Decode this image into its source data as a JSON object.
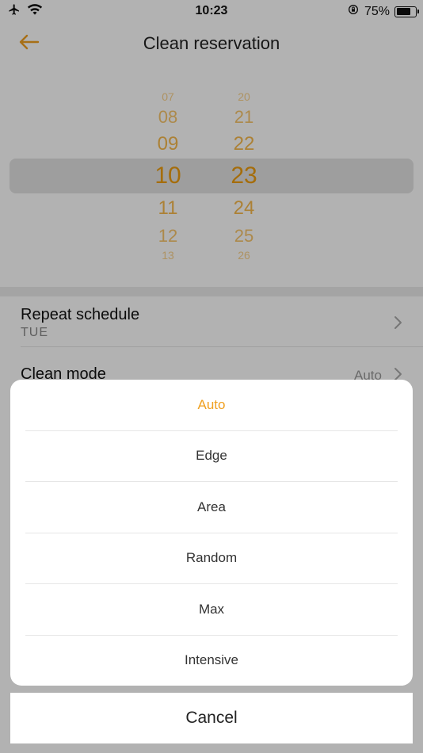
{
  "status": {
    "time": "10:23",
    "battery_text": "75%",
    "battery_level": 0.75
  },
  "nav": {
    "title": "Clean reservation",
    "accent_color": "#f0a020"
  },
  "picker": {
    "hours": [
      "07",
      "08",
      "09",
      "10",
      "11",
      "12",
      "13"
    ],
    "minutes": [
      "20",
      "21",
      "22",
      "23",
      "24",
      "25",
      "26"
    ],
    "selected_hour": "10",
    "selected_minute": "23"
  },
  "settings": {
    "repeat": {
      "label": "Repeat schedule",
      "value": "TUE"
    },
    "mode": {
      "label": "Clean mode",
      "value": "Auto"
    }
  },
  "action_sheet": {
    "options": [
      {
        "label": "Auto",
        "selected": true
      },
      {
        "label": "Edge",
        "selected": false
      },
      {
        "label": "Area",
        "selected": false
      },
      {
        "label": "Random",
        "selected": false
      },
      {
        "label": "Max",
        "selected": false
      },
      {
        "label": "Intensive",
        "selected": false
      }
    ],
    "cancel_label": "Cancel"
  }
}
